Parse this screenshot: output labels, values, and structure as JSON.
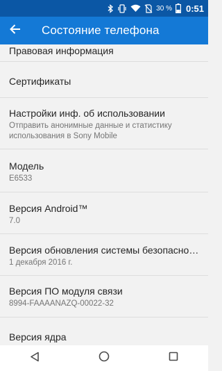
{
  "status_bar": {
    "battery_percent": "30 %",
    "time": "0:51",
    "icons": [
      "bluetooth-icon",
      "vibrate-icon",
      "wifi-icon",
      "no-sim-icon",
      "battery-icon"
    ]
  },
  "app_bar": {
    "title": "Состояние телефона",
    "back_icon": "arrow-left-icon",
    "color": "#1479d6"
  },
  "list": {
    "items": [
      {
        "title": "Правовая информация"
      },
      {
        "title": "Сертификаты"
      },
      {
        "title": "Настройки инф. об использовании",
        "subtitle_line1": "Отправить анонимные данные и статистику",
        "subtitle_line2": "использования в Sony Mobile"
      },
      {
        "title": "Модель",
        "subtitle": "E6533"
      },
      {
        "title": "Версия Android™",
        "subtitle": "7.0"
      },
      {
        "title": "Версия обновления системы безопасност..",
        "subtitle": "1 декабря 2016 г."
      },
      {
        "title": "Версия ПО модуля связи",
        "subtitle": "8994-FAAAANAZQ-00022-32"
      },
      {
        "title": "Версия ядра"
      }
    ]
  },
  "nav_bar": {
    "buttons": [
      "back-triangle-icon",
      "home-circle-icon",
      "recents-square-icon"
    ]
  }
}
